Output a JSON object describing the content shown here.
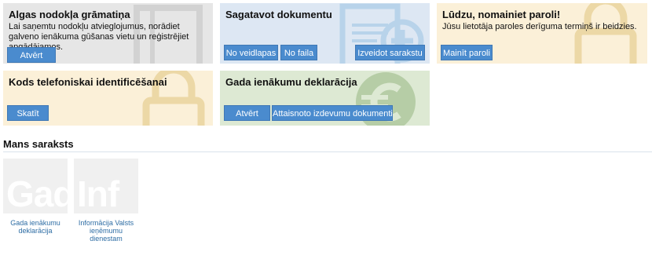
{
  "tiles": {
    "algas": {
      "title": "Algas nodokļa grāmatiņa",
      "desc": "Lai saņemtu nodokļu atvieglojumus, norādiet galveno ienākuma gūšanas vietu un reģistrējiet apgādājamos.",
      "btn_open": "Atvērt",
      "color": "#e6e6e6"
    },
    "sagatavot": {
      "title": "Sagatavot dokumentu",
      "btn_template": "No veidlapas",
      "btn_file": "No faila",
      "btn_create_list": "Izveidot sarakstu",
      "color": "#dde7f3"
    },
    "parole": {
      "title": "Lūdzu, nomainiet paroli!",
      "desc": "Jūsu lietotāja paroles derīguma termiņš ir beidzies.",
      "btn_change": "Mainīt paroli",
      "color": "#fbf0d8"
    },
    "kods": {
      "title": "Kods telefoniskai identificēšanai",
      "btn_view": "Skatīt",
      "color": "#fbf0d8"
    },
    "deklaracija": {
      "title": "Gada ienākumu deklarācija",
      "btn_open": "Atvērt",
      "btn_expenses": "Attaisnoto izdevumu dokumenti",
      "color": "#dde9d3"
    }
  },
  "my_list": {
    "title": "Mans saraksts",
    "items": [
      {
        "bg_text": "Gad",
        "label": "Gada ienākumu deklarācija"
      },
      {
        "bg_text": "Inf",
        "label": "Informācija Valsts ieņēmumu dienestam"
      }
    ]
  }
}
